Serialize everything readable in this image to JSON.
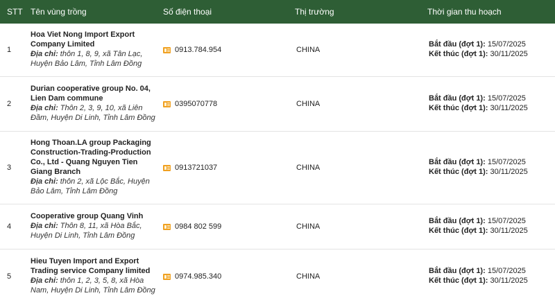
{
  "table": {
    "headers": {
      "stt": "STT",
      "name": "Tên vùng trồng",
      "phone": "Số điện thoại",
      "market": "Thị trường",
      "harvest": "Thời gian thu hoạch"
    },
    "address_label": "Địa chỉ:",
    "start_label": "Bắt đầu (đợt 1):",
    "end_label": "Kết thúc (đợt 1):",
    "rows": [
      {
        "stt": "1",
        "name": "Hoa Viet Nong Import Export Company Limited",
        "address": "thôn 1, 8, 9, xã Tân Lạc, Huyện Bảo Lâm, Tỉnh Lâm Đồng",
        "phone": "0913.784.954",
        "market": "CHINA",
        "start": "15/07/2025",
        "end": "30/11/2025"
      },
      {
        "stt": "2",
        "name": "Durian cooperative group No. 04, Lien Dam commune",
        "address": "Thôn 2, 3, 9, 10, xã Liên Đầm, Huyện Di Linh, Tỉnh Lâm Đồng",
        "phone": "0395070778",
        "market": "CHINA",
        "start": "15/07/2025",
        "end": "30/11/2025"
      },
      {
        "stt": "3",
        "name": "Hong Thoan.LA group Packaging Construction-Trading-Production Co., Ltd - Quang Nguyen Tien Giang Branch",
        "address": "thôn 2, xã Lộc Bắc, Huyện Bảo Lâm, Tỉnh Lâm Đồng",
        "phone": "0913721037",
        "market": "CHINA",
        "start": "15/07/2025",
        "end": "30/11/2025"
      },
      {
        "stt": "4",
        "name": "Cooperative group Quang Vinh",
        "address": "Thôn 8, 11, xã Hòa Bắc, Huyện Di Linh, Tỉnh Lâm Đồng",
        "phone": "0984 802 599",
        "market": "CHINA",
        "start": "15/07/2025",
        "end": "30/11/2025"
      },
      {
        "stt": "5",
        "name": "Hieu Tuyen Import and Export Trading service Company limited",
        "address": "thôn 1, 2, 3, 5, 8, xã Hòa Nam, Huyện Di Linh, Tỉnh Lâm Đồng",
        "phone": "0974.985.340",
        "market": "CHINA",
        "start": "15/07/2025",
        "end": "30/11/2025"
      }
    ]
  }
}
